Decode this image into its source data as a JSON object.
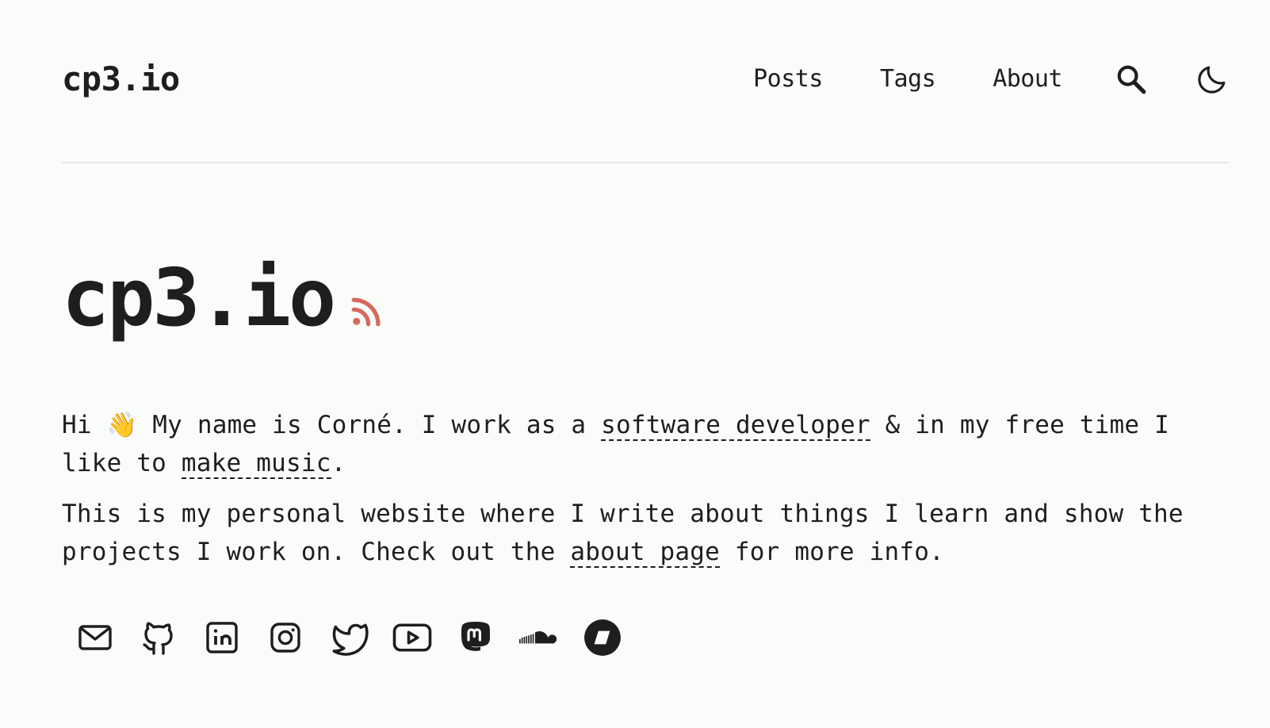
{
  "header": {
    "logo": "cp3.io",
    "nav": [
      {
        "label": "Posts"
      },
      {
        "label": "Tags"
      },
      {
        "label": "About"
      }
    ],
    "search_icon": "search-icon",
    "theme_icon": "moon-icon"
  },
  "main": {
    "title": "cp3.io",
    "rss_icon": "rss-icon",
    "rss_color": "#d5695d",
    "intro": {
      "p1_a": "Hi 👋 My name is Corné. I work as a ",
      "p1_link1": "software developer",
      "p1_b": " & in my free time I like to ",
      "p1_link2": "make music",
      "p1_c": ".",
      "p2_a": "This is my personal website where I write about things I learn and show the projects I work on. Check out the ",
      "p2_link": "about page",
      "p2_b": " for more info."
    },
    "social": [
      "email-icon",
      "github-icon",
      "linkedin-icon",
      "instagram-icon",
      "twitter-icon",
      "youtube-icon",
      "mastodon-icon",
      "soundcloud-icon",
      "bandcamp-icon"
    ]
  },
  "colors": {
    "background": "#fafcfa",
    "text": "#1e1e1e",
    "divider": "#e5e7e6"
  }
}
